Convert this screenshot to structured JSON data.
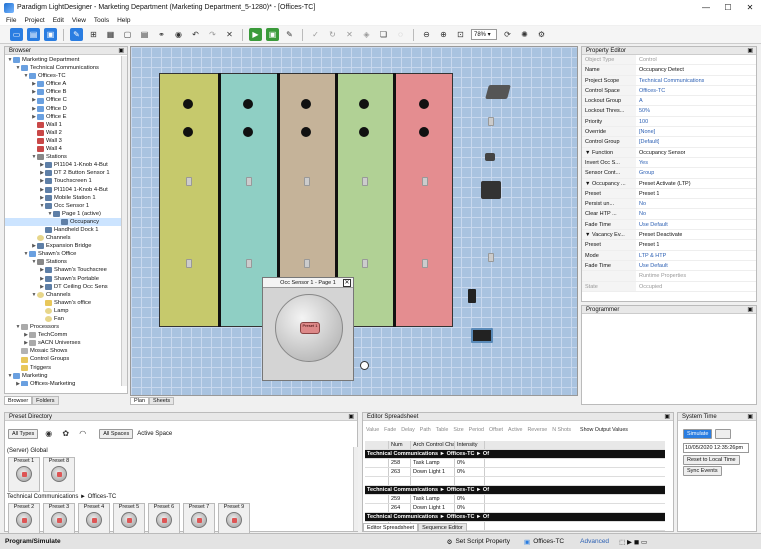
{
  "window": {
    "title": "Paradigm LightDesigner - Marketing Department (Marketing Department_5-1280)* - [Offices-TC]"
  },
  "menu": [
    "File",
    "Project",
    "Edit",
    "View",
    "Tools",
    "Help"
  ],
  "toolbar": {
    "zoom": "78%"
  },
  "browser": {
    "title": "Browser",
    "tree": [
      {
        "label": "Marketing Department",
        "d": 0,
        "ico": "area",
        "exp": "▼"
      },
      {
        "label": "Technical Communications",
        "d": 1,
        "ico": "area",
        "exp": "▼"
      },
      {
        "label": "Offices-TC",
        "d": 2,
        "ico": "area",
        "exp": "▼"
      },
      {
        "label": "Office A",
        "d": 3,
        "ico": "area",
        "exp": "▶"
      },
      {
        "label": "Office B",
        "d": 3,
        "ico": "area",
        "exp": "▶"
      },
      {
        "label": "Office C",
        "d": 3,
        "ico": "area",
        "exp": "▶"
      },
      {
        "label": "Office D",
        "d": 3,
        "ico": "area",
        "exp": "▶"
      },
      {
        "label": "Office E",
        "d": 3,
        "ico": "area",
        "exp": "▶"
      },
      {
        "label": "Wall 1",
        "d": 3,
        "ico": "wall",
        "exp": ""
      },
      {
        "label": "Wall 2",
        "d": 3,
        "ico": "wall",
        "exp": ""
      },
      {
        "label": "Wall 3",
        "d": 3,
        "ico": "wall",
        "exp": ""
      },
      {
        "label": "Wall 4",
        "d": 3,
        "ico": "wall",
        "exp": ""
      },
      {
        "label": "Stations",
        "d": 3,
        "ico": "station",
        "exp": "▼"
      },
      {
        "label": "PI1104 1-Knob 4-But",
        "d": 4,
        "ico": "kp",
        "exp": "▶"
      },
      {
        "label": "DT 2 Button Sensor 1",
        "d": 4,
        "ico": "kp",
        "exp": "▶"
      },
      {
        "label": "Touchscreen 1",
        "d": 4,
        "ico": "kp",
        "exp": "▶"
      },
      {
        "label": "PI1104 1-Knob 4-But",
        "d": 4,
        "ico": "kp",
        "exp": "▶"
      },
      {
        "label": "Mobile Station 1",
        "d": 4,
        "ico": "kp",
        "exp": "▶"
      },
      {
        "label": "Occ Sensor 1",
        "d": 4,
        "ico": "kp",
        "exp": "▼"
      },
      {
        "label": "Page 1 (active)",
        "d": 5,
        "ico": "kp",
        "exp": "▼"
      },
      {
        "label": "Occupancy",
        "d": 6,
        "ico": "kp",
        "exp": "",
        "sel": true
      },
      {
        "label": "Handheld Dock 1",
        "d": 4,
        "ico": "kp",
        "exp": ""
      },
      {
        "label": "Channels",
        "d": 3,
        "ico": "chan",
        "exp": ""
      },
      {
        "label": "Expansion Bridge",
        "d": 3,
        "ico": "kp",
        "exp": "▶"
      },
      {
        "label": "Shawn's Office",
        "d": 2,
        "ico": "area",
        "exp": "▼"
      },
      {
        "label": "Stations",
        "d": 3,
        "ico": "station",
        "exp": "▼"
      },
      {
        "label": "Shawn's Touchscree",
        "d": 4,
        "ico": "kp",
        "exp": "▶"
      },
      {
        "label": "Shawn's Portable",
        "d": 4,
        "ico": "kp",
        "exp": "▶"
      },
      {
        "label": "DT Ceiling Occ Sens",
        "d": 4,
        "ico": "kp",
        "exp": "▶"
      },
      {
        "label": "Channels",
        "d": 3,
        "ico": "chan",
        "exp": "▼"
      },
      {
        "label": "Shawn's office",
        "d": 4,
        "ico": "folder",
        "exp": ""
      },
      {
        "label": "Lamp",
        "d": 4,
        "ico": "chan",
        "exp": ""
      },
      {
        "label": "Fan",
        "d": 4,
        "ico": "chan",
        "exp": ""
      },
      {
        "label": "Processors",
        "d": 1,
        "ico": "proc",
        "exp": "▼"
      },
      {
        "label": "TechComm",
        "d": 2,
        "ico": "proc",
        "exp": "▶"
      },
      {
        "label": "sACN Universes",
        "d": 2,
        "ico": "proc",
        "exp": "▶"
      },
      {
        "label": "Mosaic Shows",
        "d": 1,
        "ico": "mosaic",
        "exp": ""
      },
      {
        "label": "Control Groups",
        "d": 1,
        "ico": "folder",
        "exp": ""
      },
      {
        "label": "Triggers",
        "d": 1,
        "ico": "folder",
        "exp": ""
      },
      {
        "label": "Marketing",
        "d": 0,
        "ico": "area",
        "exp": "▼"
      },
      {
        "label": "Offices-Marketing",
        "d": 1,
        "ico": "area",
        "exp": "▶"
      }
    ],
    "tabs": [
      "Browser",
      "Folders"
    ]
  },
  "canvas": {
    "tabs": [
      "Plan",
      "Sheets"
    ],
    "popup_title": "Occ Sensor 1 - Page 1",
    "popup_button": "Preset 1"
  },
  "property_editor": {
    "title": "Property Editor",
    "rows": [
      {
        "k": "Object Type",
        "v": "Control",
        "cls": "hdr"
      },
      {
        "k": "Name",
        "v": "Occupancy Detect",
        "cls": ""
      },
      {
        "k": "Project Scope",
        "v": "Technical Communications",
        "cls": "blue"
      },
      {
        "k": "Control Space",
        "v": "Offices-TC",
        "cls": "blue"
      },
      {
        "k": "Lockout Group",
        "v": "A",
        "cls": "blue"
      },
      {
        "k": "Lockout Thres...",
        "v": "50%",
        "cls": "blue"
      },
      {
        "k": "Priority",
        "v": "100",
        "cls": "blue"
      },
      {
        "k": "Override",
        "v": "[None]",
        "cls": "blue"
      },
      {
        "k": "Control Group",
        "v": "[Default]",
        "cls": "blue"
      },
      {
        "k": "▼ Function",
        "v": "Occupancy Sensor",
        "cls": ""
      },
      {
        "k": "   Invert Occ S...",
        "v": "Yes",
        "cls": "blue"
      },
      {
        "k": "   Sensor Cont...",
        "v": "Group",
        "cls": "blue"
      },
      {
        "k": " ▼ Occupancy ...",
        "v": "Preset Activate (LTP)",
        "cls": ""
      },
      {
        "k": "      Preset",
        "v": "Preset 1",
        "cls": ""
      },
      {
        "k": "      Persist un...",
        "v": "No",
        "cls": "blue"
      },
      {
        "k": "      Clear HTP ...",
        "v": "No",
        "cls": "blue"
      },
      {
        "k": "      Fade Time",
        "v": "Use Default",
        "cls": "blue"
      },
      {
        "k": " ▼ Vacancy Ev...",
        "v": "Preset Deactivate",
        "cls": ""
      },
      {
        "k": "      Preset",
        "v": "Preset 1",
        "cls": ""
      },
      {
        "k": "      Mode",
        "v": "LTP & HTP",
        "cls": "blue"
      },
      {
        "k": "      Fade Time",
        "v": "Use Default",
        "cls": "blue"
      },
      {
        "k": "",
        "v": "Runtime Properties",
        "cls": "hdr"
      },
      {
        "k": "State",
        "v": "Occupied",
        "cls": "hdr"
      }
    ]
  },
  "programmer": {
    "title": "Programmer"
  },
  "preset_directory": {
    "title": "Preset Directory",
    "all_types": "All Types",
    "all_spaces": "All Spaces",
    "active_space": "Active Space",
    "server_global": "(Server) Global",
    "group2_path": "Technical Communications ► Offices-TC",
    "global_presets": [
      "Preset 1",
      "Preset 8"
    ],
    "tc_presets": [
      "Preset 2",
      "Preset 3",
      "Preset 4",
      "Preset 5",
      "Preset 6",
      "Preset 7",
      "Preset 9"
    ]
  },
  "editor_spreadsheet": {
    "title": "Editor Spreadsheet",
    "filters": [
      "Value",
      "Fade",
      "Delay",
      "Path",
      "Table",
      "Size",
      "Period",
      "Offset",
      "Active",
      "Reverse",
      "N Shots"
    ],
    "show_output": "Show Output Values",
    "columns": [
      "",
      "Num",
      "Arch Control Channel",
      "Intensity"
    ],
    "rows": [
      {
        "band": "Technical Communications ► Offices-TC ► Of"
      },
      {
        "cells": [
          "",
          "258",
          "Task Lamp",
          "0%"
        ]
      },
      {
        "cells": [
          "",
          "263",
          "Down Light 1",
          "0%"
        ]
      },
      {
        "cells": [
          "",
          "",
          "",
          ""
        ]
      },
      {
        "band": "Technical Communications ► Offices-TC ► Of"
      },
      {
        "cells": [
          "",
          "259",
          "Task Lamp",
          "0%"
        ]
      },
      {
        "cells": [
          "",
          "264",
          "Down Light 1",
          "0%"
        ]
      },
      {
        "band": "Technical Communications ► Offices-TC ► Of"
      },
      {
        "cells": [
          "",
          "260",
          "Task Lamp",
          "0%"
        ]
      }
    ],
    "tabs": [
      "Editor Spreadsheet",
      "Sequence Editor"
    ]
  },
  "system_time": {
    "title": "System Time",
    "simulate": "Simulate",
    "datetime": "10/05/2020 12:35:26pm",
    "reset": "Reset to Local Time",
    "sync": "Sync Events"
  },
  "status": {
    "left": "Program/Simulate",
    "set_script": "Set Script Property",
    "space": "Offices-TC",
    "advanced": "Advanced"
  }
}
